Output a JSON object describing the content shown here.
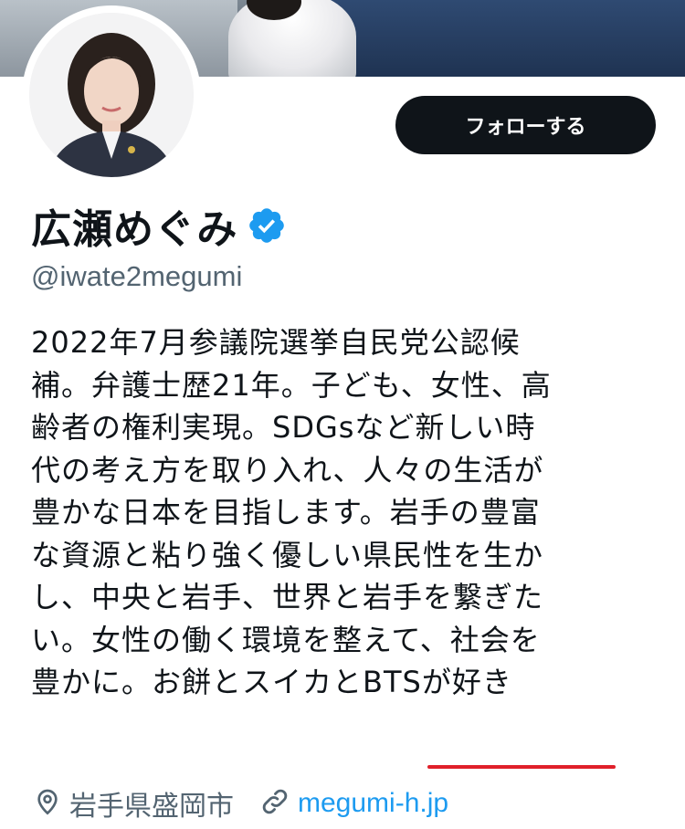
{
  "profile": {
    "display_name": "広瀬めぐみ",
    "handle": "@iwate2megumi",
    "follow_label": "フォローする",
    "verified": true,
    "bio_lines": [
      "2022年7月参議院選挙自民党公認候",
      "補。弁護士歴21年。子ども、女性、高",
      "齢者の権利実現。SDGsなど新しい時",
      "代の考え方を取り入れ、人々の生活が",
      "豊かな日本を目指します。岩手の豊富",
      "な資源と粘り強く優しい県民性を生か",
      "し、中央と岩手、世界と岩手を繋ぎた",
      "い。女性の働く環境を整えて、社会を",
      "豊かに。お餅とスイカとBTSが好き"
    ],
    "location": "岩手県盛岡市",
    "website": "megumi-h.jp"
  },
  "colors": {
    "follow_button_bg": "#0f1419",
    "secondary_text": "#536471",
    "link": "#1d9bf0",
    "verified_badge": "#1d9bf0",
    "annotation_underline": "#e0202a"
  },
  "icons": {
    "verified": "verified-badge-icon",
    "location": "location-pin-icon",
    "link": "link-icon"
  }
}
